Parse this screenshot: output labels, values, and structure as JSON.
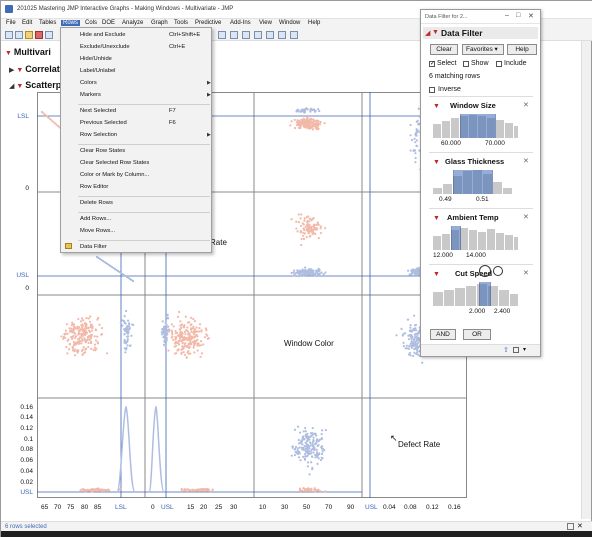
{
  "window": {
    "title": "201025 Mastering JMP Interactive Graphs - Making Windows - Multivariate - JMP",
    "status": "6 rows selected"
  },
  "menubar": [
    "File",
    "Edit",
    "Tables",
    "Rows",
    "Cols",
    "DOE",
    "Analyze",
    "Graph",
    "Tools",
    "Predictive",
    "Add-Ins",
    "View",
    "Window",
    "Help"
  ],
  "outline": {
    "multivariate": "Multivari",
    "correlations": "Correlatio",
    "scatterplot": "Scatterp"
  },
  "rows_menu": {
    "items": [
      {
        "label": "Hide and Exclude",
        "shortcut": "Ctrl+Shift+E"
      },
      {
        "label": "Exclude/Unexclude",
        "shortcut": "Ctrl+E"
      },
      {
        "label": "Hide/Unhide",
        "shortcut": ""
      },
      {
        "label": "Label/Unlabel",
        "shortcut": ""
      },
      {
        "label": "Colors",
        "shortcut": "",
        "submenu": true
      },
      {
        "label": "Markers",
        "shortcut": "",
        "submenu": true
      },
      {
        "label": "Next Selected",
        "shortcut": "F7"
      },
      {
        "label": "Previous Selected",
        "shortcut": "F6"
      },
      {
        "label": "Row Selection",
        "shortcut": "",
        "submenu": true
      },
      {
        "label": "Clear Row States",
        "shortcut": ""
      },
      {
        "label": "Clear Selected Row States",
        "shortcut": ""
      },
      {
        "label": "Color or Mark by Column...",
        "shortcut": ""
      },
      {
        "label": "Row Editor",
        "shortcut": ""
      },
      {
        "label": "Delete Rows",
        "shortcut": ""
      },
      {
        "label": "Add Rows...",
        "shortcut": ""
      },
      {
        "label": "Move Rows...",
        "shortcut": ""
      },
      {
        "label": "Data Filter",
        "shortcut": ""
      }
    ]
  },
  "plot": {
    "y_ticks_upper": [
      "LSL",
      "0"
    ],
    "y_ticks_mid": [
      "USL",
      "0"
    ],
    "y_ticks_lower": [
      "0.16",
      "0.14",
      "0.12",
      "0.1",
      "0.08",
      "0.06",
      "0.04",
      "0.02",
      "USL"
    ],
    "diag_labels": {
      "rate": "Rate",
      "window_color": "Window Color",
      "defect_rate": "Defect Rate"
    },
    "x_ticks": [
      "65",
      "70",
      "75",
      "80",
      "85",
      "LSL",
      "0",
      "USL",
      "15",
      "20",
      "25",
      "30",
      "10",
      "30",
      "50",
      "70",
      "90",
      "USL",
      "0.04",
      "0.08",
      "0.12",
      "0.16"
    ]
  },
  "data_filter": {
    "window_title": "Data Filter for 2...",
    "title": "Data Filter",
    "clear": "Clear",
    "favorites": "Favorites",
    "help": "Help",
    "select": "Select",
    "show": "Show",
    "include": "Include",
    "matching": "6 matching rows",
    "inverse": "Inverse",
    "sections": [
      {
        "name": "Window Size",
        "lo": "60.000",
        "hi": "70.000"
      },
      {
        "name": "Glass Thickness",
        "lo": "0.49",
        "hi": "0.51"
      },
      {
        "name": "Ambient Temp",
        "lo": "12.000",
        "hi": "14.000"
      },
      {
        "name": "Cut Speed",
        "lo": "2.000",
        "hi": "2.400"
      }
    ],
    "and": "AND",
    "or": "OR"
  },
  "colors": {
    "accent": "#3f6bb7",
    "pink": "#f2b8a8",
    "lightblue": "#aebde0",
    "red": "#c0282f"
  }
}
